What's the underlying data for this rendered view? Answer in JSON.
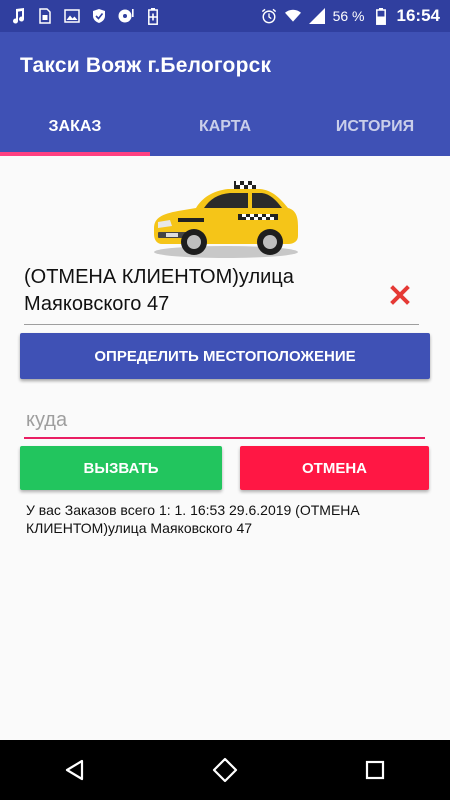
{
  "status_bar": {
    "battery_percent": "56 %",
    "time": "16:54",
    "icons": [
      "music-icon",
      "sim-icon",
      "image-icon",
      "shield-icon",
      "media-icon",
      "battery-saver-icon",
      "alarm-icon",
      "wifi-icon",
      "signal-icon",
      "battery-icon"
    ]
  },
  "app": {
    "title": "Такси Вояж г.Белогорск",
    "colors": {
      "primary": "#3f51b5",
      "primary_dark": "#303f9f",
      "accent": "#ff4081",
      "call_green": "#22c55e",
      "cancel_red": "#ff1744"
    }
  },
  "tabs": [
    {
      "label": "ЗАКАЗ",
      "active": true
    },
    {
      "label": "КАРТА",
      "active": false
    },
    {
      "label": "ИСТОРИЯ",
      "active": false
    }
  ],
  "order": {
    "address_line1": "(ОТМЕНА КЛИЕНТОМ)улица",
    "address_line2": "Маяковского 47",
    "clear_icon": "close-icon",
    "locate_button": "ОПРЕДЕЛИТЬ МЕСТОПОЛОЖЕНИЕ",
    "destination_placeholder": "куда",
    "destination_value": "",
    "call_button": "ВЫЗВАТЬ",
    "cancel_button": "ОТМЕНА",
    "orders_text": "У вас Заказов всего 1:  1. 16:53 29.6.2019 (ОТМЕНА КЛИЕНТОМ)улица Маяковского 47"
  },
  "nav_bar": [
    "back-icon",
    "home-icon",
    "recents-icon"
  ]
}
